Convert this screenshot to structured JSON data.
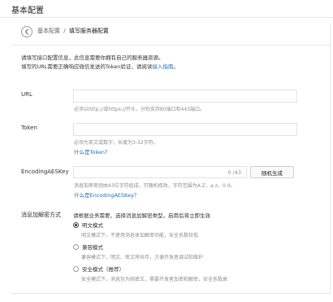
{
  "header": {
    "title": "基本配置"
  },
  "breadcrumb": {
    "previous": "基本配置",
    "separator": "/",
    "current": "填写服务器配置"
  },
  "notice": {
    "line1": "请填写接口配置信息，此信息需要你拥有自己的服务器资源。",
    "line2_text": "填写的URL需要正确响应微信发送的Token验证，请阅读",
    "line2_link": "接入指南",
    "line2_end": "。"
  },
  "url": {
    "label": "URL",
    "value": "",
    "hint": "必须以http://或https://开头，分别支持80端口和443端口。"
  },
  "token": {
    "label": "Token",
    "value": "",
    "hint": "必须为英文或数字，长度为3-32字符。",
    "link": "什么是Token？"
  },
  "aes": {
    "label": "EncodingAESKey",
    "value": "",
    "counter": "0 /43",
    "generate_button": "随机生成",
    "hint": "消息加密密钥由43位字符组成，可随机修改，字符范围为A-Z，a-z，0-9。",
    "link": "什么是EncodingAESKey？"
  },
  "encryption": {
    "label": "消息加解密方式",
    "intro": "请根据业务需要，选择消息加解密类型，启用后将立即生效",
    "options": [
      {
        "label": "明文模式",
        "description": "明文模式下，不使用消息体加解密功能，安全系数较低",
        "selected": true
      },
      {
        "label": "兼容模式",
        "description": "兼容模式下，明文、密文将共存，方便开发者调试和维护",
        "selected": false
      },
      {
        "label": "安全模式（推荐）",
        "description": "安全模式下，消息包为纯密文，需要开发者加密和解密，安全系数高",
        "selected": false
      }
    ]
  }
}
